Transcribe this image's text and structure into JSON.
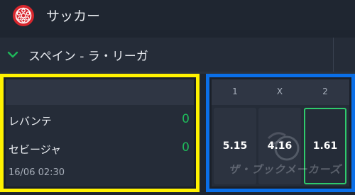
{
  "header": {
    "title": "サッカー",
    "icon": "soccer-ball-icon"
  },
  "league": {
    "name": "スペイン - ラ・リーガ",
    "icon": "chevron-down-icon"
  },
  "match": {
    "teams": [
      {
        "name": "レバンテ",
        "score": "0"
      },
      {
        "name": "セビージャ",
        "score": "0"
      }
    ],
    "time": "16/06 02:30"
  },
  "odds": {
    "labels": [
      "1",
      "X",
      "2"
    ],
    "values": [
      "5.15",
      "4.16",
      "1.61"
    ],
    "selected_index": 2
  },
  "watermark": "ザ・ブックメーカーズ",
  "colors": {
    "accent_green": "#1fb85a",
    "highlight_yellow": "#fff200",
    "highlight_blue": "#0a6fe8",
    "ball_red": "#d8262d"
  }
}
